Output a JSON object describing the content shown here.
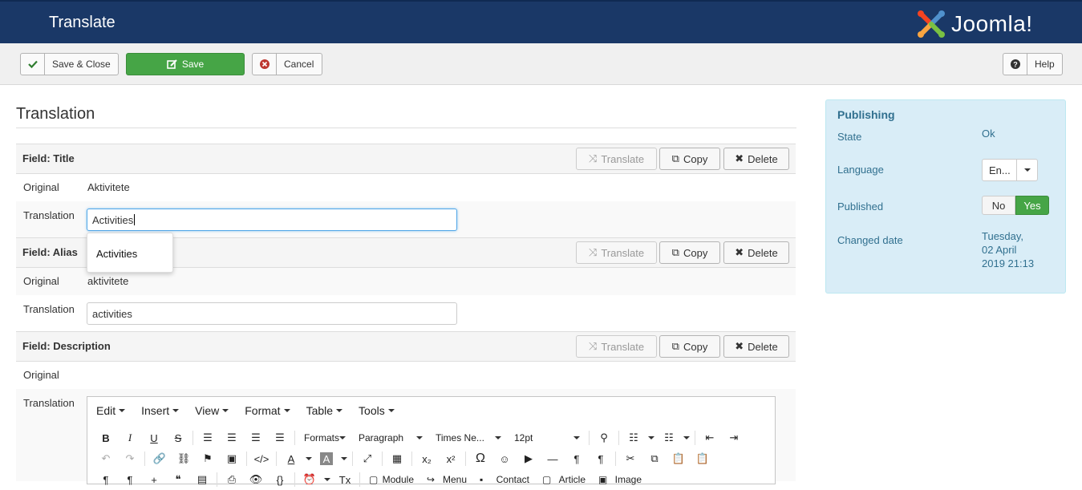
{
  "header": {
    "title": "Translate",
    "logo_text": "Joomla!"
  },
  "toolbar": {
    "save_close": "Save & Close",
    "save": "Save",
    "cancel": "Cancel",
    "help": "Help"
  },
  "page_title": "Translation",
  "field_buttons": {
    "translate": "Translate",
    "copy": "Copy",
    "delete": "Delete"
  },
  "labels": {
    "original": "Original",
    "translation": "Translation"
  },
  "fields": [
    {
      "title": "Field: Title",
      "original": "Aktivitete",
      "translation": "Activities"
    },
    {
      "title": "Field: Alias",
      "original": "aktivitete",
      "translation": "activities"
    },
    {
      "title": "Field: Description",
      "original": "",
      "translation": ""
    }
  ],
  "autocomplete": {
    "suggestion": "Activities"
  },
  "editor": {
    "menus": [
      "Edit",
      "Insert",
      "View",
      "Format",
      "Table",
      "Tools"
    ],
    "formats": "Formats",
    "block": "Paragraph",
    "font": "Times Ne...",
    "size": "12pt",
    "buttons_row3": [
      "Module",
      "Menu",
      "Contact",
      "Article",
      "Image"
    ]
  },
  "sidebar": {
    "title": "Publishing",
    "state_label": "State",
    "state_value": "Ok",
    "language_label": "Language",
    "language_value": "En...",
    "published_label": "Published",
    "no": "No",
    "yes": "Yes",
    "changed_label": "Changed date",
    "changed_line1": "Tuesday,",
    "changed_line2": "02 April",
    "changed_line3": "2019 21:13"
  },
  "colors": {
    "header_bg": "#1a3867",
    "save_green": "#46a546",
    "sidebar_bg": "#d9edf7"
  }
}
